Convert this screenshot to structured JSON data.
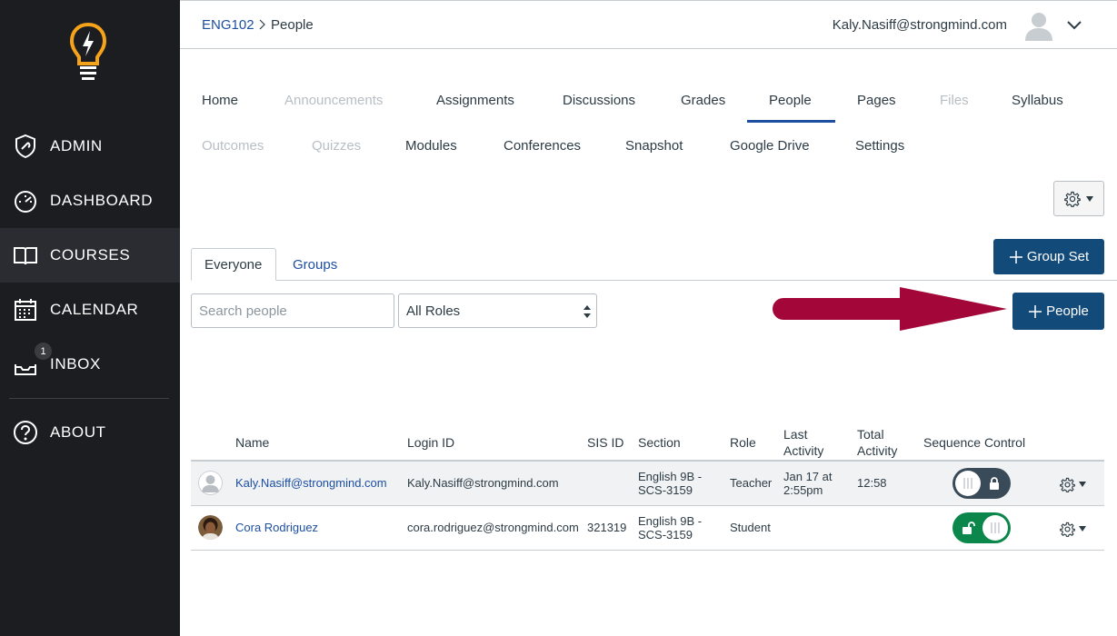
{
  "sidebar": {
    "items": [
      {
        "label": "ADMIN",
        "icon": "admin-shield-icon"
      },
      {
        "label": "DASHBOARD",
        "icon": "dashboard-gauge-icon"
      },
      {
        "label": "COURSES",
        "icon": "book-icon"
      },
      {
        "label": "CALENDAR",
        "icon": "calendar-icon"
      },
      {
        "label": "INBOX",
        "icon": "inbox-icon",
        "badge": "1"
      },
      {
        "label": "ABOUT",
        "icon": "question-icon"
      }
    ],
    "active_item": "COURSES"
  },
  "breadcrumb": {
    "course": "ENG102",
    "page": "People"
  },
  "user": {
    "email": "Kaly.Nasiff@strongmind.com"
  },
  "course_nav": {
    "row1": [
      "Home",
      "Announcements",
      "Assignments",
      "Discussions",
      "Grades",
      "People",
      "Pages",
      "Files",
      "Syllabus"
    ],
    "row2": [
      "Outcomes",
      "Quizzes",
      "Modules",
      "Conferences",
      "Snapshot",
      "Google Drive",
      "Settings"
    ],
    "active": "People",
    "disabled": [
      "Announcements",
      "Files",
      "Outcomes",
      "Quizzes"
    ]
  },
  "tabs": {
    "everyone": "Everyone",
    "groups": "Groups"
  },
  "buttons": {
    "group_set": "Group Set",
    "add_people": "People"
  },
  "filters": {
    "search_placeholder": "Search people",
    "roles_selected": "All Roles"
  },
  "table": {
    "headers": {
      "name": "Name",
      "login_id": "Login ID",
      "sis_id": "SIS ID",
      "section": "Section",
      "role": "Role",
      "last_activity_1": "Last",
      "last_activity_2": "Activity",
      "total_activity_1": "Total",
      "total_activity_2": "Activity",
      "sequence_control": "Sequence Control"
    },
    "rows": [
      {
        "name": "Kaly.Nasiff@strongmind.com",
        "login_id": "Kaly.Nasiff@strongmind.com",
        "sis_id": "",
        "section_1": "English 9B -",
        "section_2": "SCS-3159",
        "role": "Teacher",
        "last_activity_1": "Jan 17 at",
        "last_activity_2": "2:55pm",
        "total_activity": "12:58",
        "sequence_locked": true
      },
      {
        "name": "Cora Rodriguez",
        "login_id": "cora.rodriguez@strongmind.com",
        "sis_id": "321319",
        "section_1": "English 9B -",
        "section_2": "SCS-3159",
        "role": "Student",
        "last_activity_1": "",
        "last_activity_2": "",
        "total_activity": "",
        "sequence_locked": false
      }
    ]
  },
  "colors": {
    "sidebar_bg": "#1c1d21",
    "link": "#1d4fa1",
    "primary_button": "#124a7a",
    "arrow": "#a3073a",
    "toggle_on": "#0b874b",
    "toggle_off": "#394b58"
  }
}
